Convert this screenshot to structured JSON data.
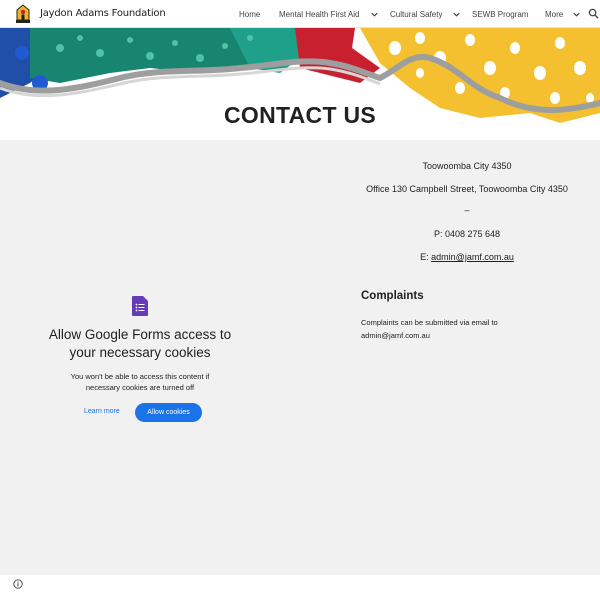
{
  "header": {
    "site_title": "Jaydon Adams Foundation",
    "nav": [
      {
        "label": "Home",
        "has_dropdown": false
      },
      {
        "label": "Mental Health First Aid",
        "has_dropdown": true
      },
      {
        "label": "Cultural Safety",
        "has_dropdown": true
      },
      {
        "label": "SEWB Program",
        "has_dropdown": false
      },
      {
        "label": "More",
        "has_dropdown": true
      }
    ],
    "search_icon": "search-icon"
  },
  "banner": {
    "title": "CONTACT US"
  },
  "contact": {
    "city": "Toowoomba City 4350",
    "office": "Office 130 Campbell Street, Toowoomba City 4350",
    "separator": "–",
    "phone": "P: 0408 275 648",
    "email_prefix": "E: ",
    "email": "admin@jamf.com.au"
  },
  "complaints": {
    "heading": "Complaints",
    "text": "Complaints can be submitted via email to admin@jamf.com.au"
  },
  "forms_consent": {
    "icon": "google-forms-icon",
    "heading": "Allow Google Forms access to your necessary cookies",
    "body": "You won't be able to access this content if necessary cookies are turned off",
    "learn_more": "Learn more",
    "allow": "Allow cookies"
  },
  "footer": {
    "info_icon": "info-icon"
  },
  "colors": {
    "accent_blue": "#1a73e8",
    "forms_purple": "#673ab7",
    "banner_teal": "#1a8a7a",
    "banner_red": "#c8202e",
    "banner_yellow": "#f5c030"
  }
}
